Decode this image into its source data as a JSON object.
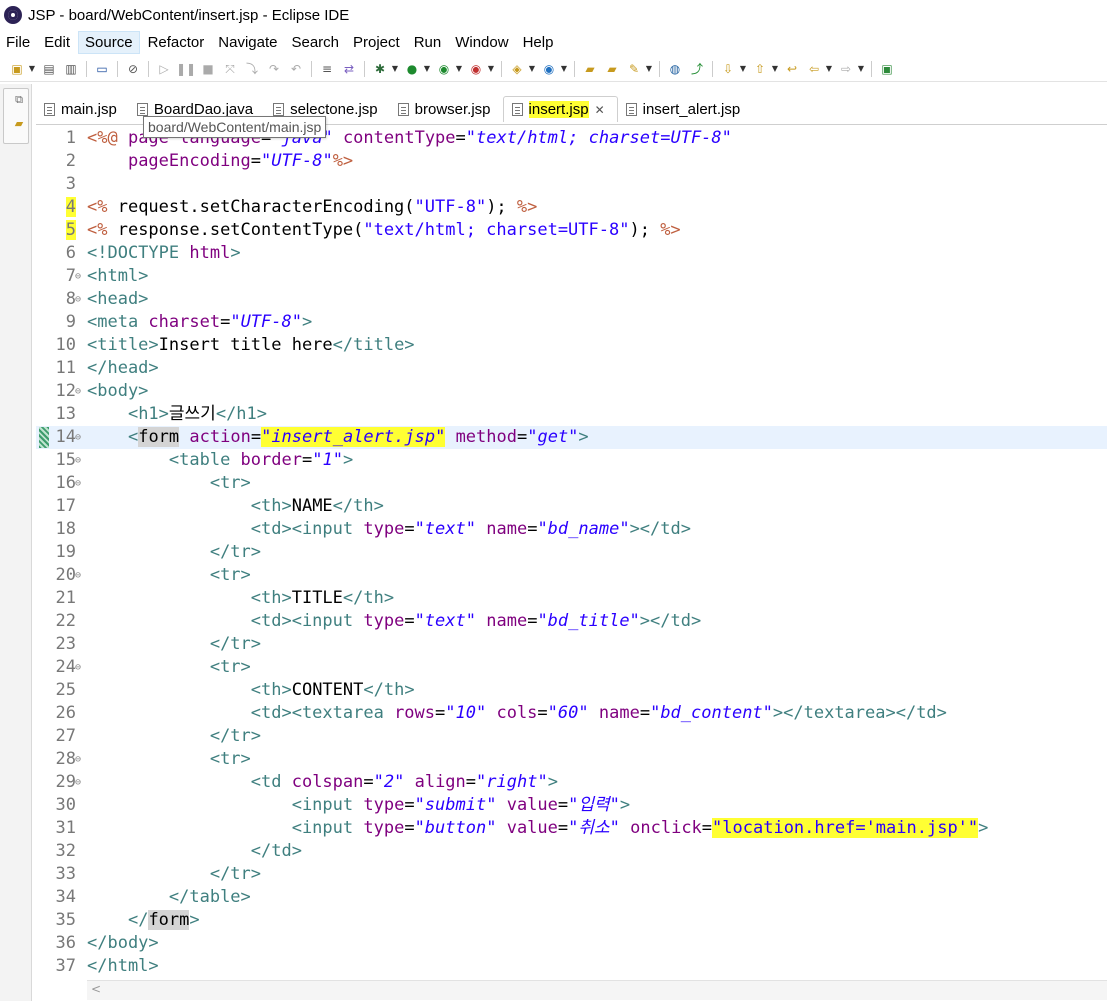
{
  "window": {
    "title": "JSP - board/WebContent/insert.jsp - Eclipse IDE"
  },
  "menu": [
    "File",
    "Edit",
    "Source",
    "Refactor",
    "Navigate",
    "Search",
    "Project",
    "Run",
    "Window",
    "Help"
  ],
  "tabs": [
    {
      "label": "main.jsp"
    },
    {
      "label": "BoardDao.java"
    },
    {
      "label": "selectone.jsp"
    },
    {
      "label": "browser.jsp"
    },
    {
      "label": "insert.jsp"
    },
    {
      "label": "insert_alert.jsp"
    }
  ],
  "tooltip": "board/WebContent/main.jsp",
  "lines": [
    {
      "n": "1",
      "tokens": [
        [
          "t-jsp",
          "<%@ "
        ],
        [
          "t-attr",
          "page language"
        ],
        [
          "t-txt",
          "="
        ],
        [
          "t-val",
          "\"java\""
        ],
        [
          "t-txt",
          " "
        ],
        [
          "t-attr",
          "contentType"
        ],
        [
          "t-txt",
          "="
        ],
        [
          "t-val",
          "\"text/html; charset=UTF-8\""
        ]
      ]
    },
    {
      "n": "2",
      "tokens": [
        [
          "t-txt",
          "    "
        ],
        [
          "t-attr",
          "pageEncoding"
        ],
        [
          "t-txt",
          "="
        ],
        [
          "t-val",
          "\"UTF-8\""
        ],
        [
          "t-jsp",
          "%>"
        ]
      ]
    },
    {
      "n": "3",
      "tokens": []
    },
    {
      "n": "4",
      "tokens": [
        [
          "t-jsp",
          "<% "
        ],
        [
          "t-txt",
          "request.setCharacterEncoding("
        ],
        [
          "t-str",
          "\"UTF-8\""
        ],
        [
          "t-txt",
          "); "
        ],
        [
          "t-jsp",
          "%>"
        ]
      ]
    },
    {
      "n": "5",
      "tokens": [
        [
          "t-jsp",
          "<% "
        ],
        [
          "t-txt",
          "response.setContentType("
        ],
        [
          "t-str",
          "\"text/html; charset=UTF-8\""
        ],
        [
          "t-txt",
          "); "
        ],
        [
          "t-jsp",
          "%>"
        ]
      ]
    },
    {
      "n": "6",
      "tokens": [
        [
          "t-tag",
          "<!DOCTYPE "
        ],
        [
          "t-attr",
          "html"
        ],
        [
          "t-tag",
          ">"
        ]
      ]
    },
    {
      "n": "7",
      "tokens": [
        [
          "t-tag",
          "<html>"
        ]
      ]
    },
    {
      "n": "8",
      "tokens": [
        [
          "t-tag",
          "<head>"
        ]
      ]
    },
    {
      "n": "9",
      "tokens": [
        [
          "t-tag",
          "<meta "
        ],
        [
          "t-attr",
          "charset"
        ],
        [
          "t-txt",
          "="
        ],
        [
          "t-val",
          "\"UTF-8\""
        ],
        [
          "t-tag",
          ">"
        ]
      ]
    },
    {
      "n": "10",
      "tokens": [
        [
          "t-tag",
          "<title>"
        ],
        [
          "t-txt",
          "Insert title here"
        ],
        [
          "t-tag",
          "</title>"
        ]
      ]
    },
    {
      "n": "11",
      "tokens": [
        [
          "t-tag",
          "</head>"
        ]
      ]
    },
    {
      "n": "12",
      "tokens": [
        [
          "t-tag",
          "<body>"
        ]
      ]
    },
    {
      "n": "13",
      "tokens": [
        [
          "t-txt",
          "    "
        ],
        [
          "t-tag",
          "<h1>"
        ],
        [
          "t-txt",
          "글쓰기"
        ],
        [
          "t-tag",
          "</h1>"
        ]
      ]
    },
    {
      "n": "14",
      "tokens": [
        [
          "t-txt",
          "    "
        ],
        [
          "t-tag",
          "<"
        ],
        [
          "t-box",
          "form"
        ],
        [
          "t-txt",
          " "
        ],
        [
          "t-attr",
          "action"
        ],
        [
          "t-txt",
          "="
        ],
        [
          "t-val t-hl",
          "\"insert_alert.jsp\""
        ],
        [
          "t-txt",
          " "
        ],
        [
          "t-attr",
          "method"
        ],
        [
          "t-txt",
          "="
        ],
        [
          "t-val",
          "\"get\""
        ],
        [
          "t-tag",
          ">"
        ]
      ]
    },
    {
      "n": "15",
      "tokens": [
        [
          "t-txt",
          "        "
        ],
        [
          "t-tag",
          "<table "
        ],
        [
          "t-attr",
          "border"
        ],
        [
          "t-txt",
          "="
        ],
        [
          "t-val",
          "\"1\""
        ],
        [
          "t-tag",
          ">"
        ]
      ]
    },
    {
      "n": "16",
      "tokens": [
        [
          "t-txt",
          "            "
        ],
        [
          "t-tag",
          "<tr>"
        ]
      ]
    },
    {
      "n": "17",
      "tokens": [
        [
          "t-txt",
          "                "
        ],
        [
          "t-tag",
          "<th>"
        ],
        [
          "t-txt",
          "NAME"
        ],
        [
          "t-tag",
          "</th>"
        ]
      ]
    },
    {
      "n": "18",
      "tokens": [
        [
          "t-txt",
          "                "
        ],
        [
          "t-tag",
          "<td><input "
        ],
        [
          "t-attr",
          "type"
        ],
        [
          "t-txt",
          "="
        ],
        [
          "t-val",
          "\"text\""
        ],
        [
          "t-txt",
          " "
        ],
        [
          "t-attr",
          "name"
        ],
        [
          "t-txt",
          "="
        ],
        [
          "t-val",
          "\"bd_name\""
        ],
        [
          "t-tag",
          "></td>"
        ]
      ]
    },
    {
      "n": "19",
      "tokens": [
        [
          "t-txt",
          "            "
        ],
        [
          "t-tag",
          "</tr>"
        ]
      ]
    },
    {
      "n": "20",
      "tokens": [
        [
          "t-txt",
          "            "
        ],
        [
          "t-tag",
          "<tr>"
        ]
      ]
    },
    {
      "n": "21",
      "tokens": [
        [
          "t-txt",
          "                "
        ],
        [
          "t-tag",
          "<th>"
        ],
        [
          "t-txt",
          "TITLE"
        ],
        [
          "t-tag",
          "</th>"
        ]
      ]
    },
    {
      "n": "22",
      "tokens": [
        [
          "t-txt",
          "                "
        ],
        [
          "t-tag",
          "<td><input "
        ],
        [
          "t-attr",
          "type"
        ],
        [
          "t-txt",
          "="
        ],
        [
          "t-val",
          "\"text\""
        ],
        [
          "t-txt",
          " "
        ],
        [
          "t-attr",
          "name"
        ],
        [
          "t-txt",
          "="
        ],
        [
          "t-val",
          "\"bd_title\""
        ],
        [
          "t-tag",
          "></td>"
        ]
      ]
    },
    {
      "n": "23",
      "tokens": [
        [
          "t-txt",
          "            "
        ],
        [
          "t-tag",
          "</tr>"
        ]
      ]
    },
    {
      "n": "24",
      "tokens": [
        [
          "t-txt",
          "            "
        ],
        [
          "t-tag",
          "<tr>"
        ]
      ]
    },
    {
      "n": "25",
      "tokens": [
        [
          "t-txt",
          "                "
        ],
        [
          "t-tag",
          "<th>"
        ],
        [
          "t-txt",
          "CONTENT"
        ],
        [
          "t-tag",
          "</th>"
        ]
      ]
    },
    {
      "n": "26",
      "tokens": [
        [
          "t-txt",
          "                "
        ],
        [
          "t-tag",
          "<td><textarea "
        ],
        [
          "t-attr",
          "rows"
        ],
        [
          "t-txt",
          "="
        ],
        [
          "t-val",
          "\"10\""
        ],
        [
          "t-txt",
          " "
        ],
        [
          "t-attr",
          "cols"
        ],
        [
          "t-txt",
          "="
        ],
        [
          "t-val",
          "\"60\""
        ],
        [
          "t-txt",
          " "
        ],
        [
          "t-attr",
          "name"
        ],
        [
          "t-txt",
          "="
        ],
        [
          "t-val",
          "\"bd_content\""
        ],
        [
          "t-tag",
          "></textarea></td>"
        ]
      ]
    },
    {
      "n": "27",
      "tokens": [
        [
          "t-txt",
          "            "
        ],
        [
          "t-tag",
          "</tr>"
        ]
      ]
    },
    {
      "n": "28",
      "tokens": [
        [
          "t-txt",
          "            "
        ],
        [
          "t-tag",
          "<tr>"
        ]
      ]
    },
    {
      "n": "29",
      "tokens": [
        [
          "t-txt",
          "                "
        ],
        [
          "t-tag",
          "<td "
        ],
        [
          "t-attr",
          "colspan"
        ],
        [
          "t-txt",
          "="
        ],
        [
          "t-val",
          "\"2\""
        ],
        [
          "t-txt",
          " "
        ],
        [
          "t-attr",
          "align"
        ],
        [
          "t-txt",
          "="
        ],
        [
          "t-val",
          "\"right\""
        ],
        [
          "t-tag",
          ">"
        ]
      ]
    },
    {
      "n": "30",
      "tokens": [
        [
          "t-txt",
          "                    "
        ],
        [
          "t-tag",
          "<input "
        ],
        [
          "t-attr",
          "type"
        ],
        [
          "t-txt",
          "="
        ],
        [
          "t-val",
          "\"submit\""
        ],
        [
          "t-txt",
          " "
        ],
        [
          "t-attr",
          "value"
        ],
        [
          "t-txt",
          "="
        ],
        [
          "t-val",
          "\"입력\""
        ],
        [
          "t-tag",
          ">"
        ]
      ]
    },
    {
      "n": "31",
      "tokens": [
        [
          "t-txt",
          "                    "
        ],
        [
          "t-tag",
          "<input "
        ],
        [
          "t-attr",
          "type"
        ],
        [
          "t-txt",
          "="
        ],
        [
          "t-val",
          "\"button\""
        ],
        [
          "t-txt",
          " "
        ],
        [
          "t-attr",
          "value"
        ],
        [
          "t-txt",
          "="
        ],
        [
          "t-val",
          "\"취소\""
        ],
        [
          "t-txt",
          " "
        ],
        [
          "t-attr",
          "onclick"
        ],
        [
          "t-txt",
          "="
        ],
        [
          "t-str t-hl",
          "\"location.href='main.jsp'\""
        ],
        [
          "t-tag",
          ">"
        ]
      ]
    },
    {
      "n": "32",
      "tokens": [
        [
          "t-txt",
          "                "
        ],
        [
          "t-tag",
          "</td>"
        ]
      ]
    },
    {
      "n": "33",
      "tokens": [
        [
          "t-txt",
          "            "
        ],
        [
          "t-tag",
          "</tr>"
        ]
      ]
    },
    {
      "n": "34",
      "tokens": [
        [
          "t-txt",
          "        "
        ],
        [
          "t-tag",
          "</table>"
        ]
      ]
    },
    {
      "n": "35",
      "tokens": [
        [
          "t-txt",
          "    "
        ],
        [
          "t-tag",
          "</"
        ],
        [
          "t-box",
          "form"
        ],
        [
          "t-tag",
          ">"
        ]
      ]
    },
    {
      "n": "36",
      "tokens": [
        [
          "t-tag",
          "</body>"
        ]
      ]
    },
    {
      "n": "37",
      "tokens": [
        [
          "t-tag",
          "</html>"
        ]
      ]
    }
  ]
}
